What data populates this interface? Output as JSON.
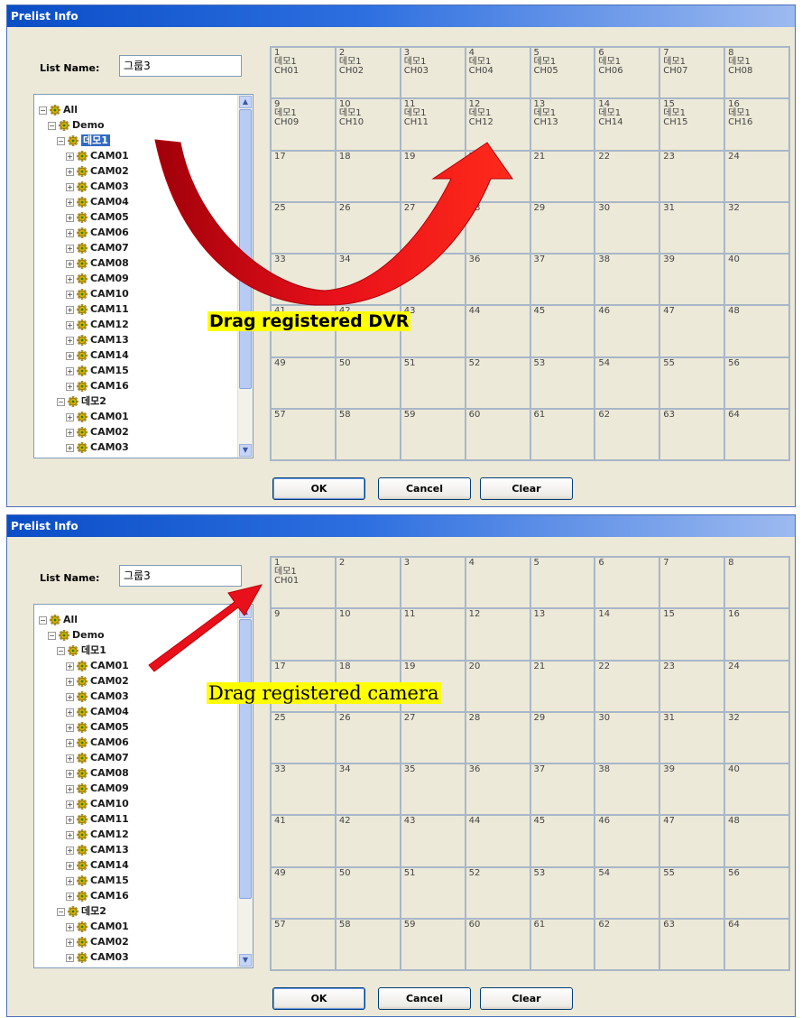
{
  "windows": [
    {
      "title": "Prelist Info",
      "list_name_label": "List Name:",
      "list_name_value": "그룹3",
      "tree": [
        {
          "label": "All",
          "level": 0,
          "expander": "−"
        },
        {
          "label": "Demo",
          "level": 1,
          "expander": "−"
        },
        {
          "label": "데모1",
          "level": 2,
          "expander": "−",
          "selected": true
        },
        {
          "label": "CAM01",
          "level": 3,
          "expander": "+"
        },
        {
          "label": "CAM02",
          "level": 3,
          "expander": "+"
        },
        {
          "label": "CAM03",
          "level": 3,
          "expander": "+"
        },
        {
          "label": "CAM04",
          "level": 3,
          "expander": "+"
        },
        {
          "label": "CAM05",
          "level": 3,
          "expander": "+"
        },
        {
          "label": "CAM06",
          "level": 3,
          "expander": "+"
        },
        {
          "label": "CAM07",
          "level": 3,
          "expander": "+"
        },
        {
          "label": "CAM08",
          "level": 3,
          "expander": "+"
        },
        {
          "label": "CAM09",
          "level": 3,
          "expander": "+"
        },
        {
          "label": "CAM10",
          "level": 3,
          "expander": "+"
        },
        {
          "label": "CAM11",
          "level": 3,
          "expander": "+"
        },
        {
          "label": "CAM12",
          "level": 3,
          "expander": "+"
        },
        {
          "label": "CAM13",
          "level": 3,
          "expander": "+"
        },
        {
          "label": "CAM14",
          "level": 3,
          "expander": "+"
        },
        {
          "label": "CAM15",
          "level": 3,
          "expander": "+"
        },
        {
          "label": "CAM16",
          "level": 3,
          "expander": "+"
        },
        {
          "label": "데모2",
          "level": 2,
          "expander": "−"
        },
        {
          "label": "CAM01",
          "level": 3,
          "expander": "+"
        },
        {
          "label": "CAM02",
          "level": 3,
          "expander": "+"
        },
        {
          "label": "CAM03",
          "level": 3,
          "expander": "+"
        }
      ],
      "channel_assignments": [
        {
          "slot": 1,
          "dvr": "데모1",
          "channel": "CH01"
        },
        {
          "slot": 2,
          "dvr": "데모1",
          "channel": "CH02"
        },
        {
          "slot": 3,
          "dvr": "데모1",
          "channel": "CH03"
        },
        {
          "slot": 4,
          "dvr": "데모1",
          "channel": "CH04"
        },
        {
          "slot": 5,
          "dvr": "데모1",
          "channel": "CH05"
        },
        {
          "slot": 6,
          "dvr": "데모1",
          "channel": "CH06"
        },
        {
          "slot": 7,
          "dvr": "데모1",
          "channel": "CH07"
        },
        {
          "slot": 8,
          "dvr": "데모1",
          "channel": "CH08"
        },
        {
          "slot": 9,
          "dvr": "데모1",
          "channel": "CH09"
        },
        {
          "slot": 10,
          "dvr": "데모1",
          "channel": "CH10"
        },
        {
          "slot": 11,
          "dvr": "데모1",
          "channel": "CH11"
        },
        {
          "slot": 12,
          "dvr": "데모1",
          "channel": "CH12"
        },
        {
          "slot": 13,
          "dvr": "데모1",
          "channel": "CH13"
        },
        {
          "slot": 14,
          "dvr": "데모1",
          "channel": "CH14"
        },
        {
          "slot": 15,
          "dvr": "데모1",
          "channel": "CH15"
        },
        {
          "slot": 16,
          "dvr": "데모1",
          "channel": "CH16"
        }
      ],
      "buttons": {
        "ok": "OK",
        "cancel": "Cancel",
        "clear": "Clear"
      },
      "annotation": "Drag registered DVR"
    },
    {
      "title": "Prelist Info",
      "list_name_label": "List Name:",
      "list_name_value": "그룹3",
      "tree": [
        {
          "label": "All",
          "level": 0,
          "expander": "−"
        },
        {
          "label": "Demo",
          "level": 1,
          "expander": "−"
        },
        {
          "label": "데모1",
          "level": 2,
          "expander": "−"
        },
        {
          "label": "CAM01",
          "level": 3,
          "expander": "+"
        },
        {
          "label": "CAM02",
          "level": 3,
          "expander": "+"
        },
        {
          "label": "CAM03",
          "level": 3,
          "expander": "+"
        },
        {
          "label": "CAM04",
          "level": 3,
          "expander": "+"
        },
        {
          "label": "CAM05",
          "level": 3,
          "expander": "+"
        },
        {
          "label": "CAM06",
          "level": 3,
          "expander": "+"
        },
        {
          "label": "CAM07",
          "level": 3,
          "expander": "+"
        },
        {
          "label": "CAM08",
          "level": 3,
          "expander": "+"
        },
        {
          "label": "CAM09",
          "level": 3,
          "expander": "+"
        },
        {
          "label": "CAM10",
          "level": 3,
          "expander": "+"
        },
        {
          "label": "CAM11",
          "level": 3,
          "expander": "+"
        },
        {
          "label": "CAM12",
          "level": 3,
          "expander": "+"
        },
        {
          "label": "CAM13",
          "level": 3,
          "expander": "+"
        },
        {
          "label": "CAM14",
          "level": 3,
          "expander": "+"
        },
        {
          "label": "CAM15",
          "level": 3,
          "expander": "+"
        },
        {
          "label": "CAM16",
          "level": 3,
          "expander": "+"
        },
        {
          "label": "데모2",
          "level": 2,
          "expander": "−"
        },
        {
          "label": "CAM01",
          "level": 3,
          "expander": "+"
        },
        {
          "label": "CAM02",
          "level": 3,
          "expander": "+"
        },
        {
          "label": "CAM03",
          "level": 3,
          "expander": "+"
        }
      ],
      "channel_assignments": [
        {
          "slot": 1,
          "dvr": "데모1",
          "channel": "CH01"
        }
      ],
      "buttons": {
        "ok": "OK",
        "cancel": "Cancel",
        "clear": "Clear"
      },
      "annotation": "Drag registered camera"
    }
  ],
  "colors": {
    "arrow_red": "#e8101a",
    "highlight": "#ffff00",
    "selection": "#316ac5"
  },
  "icons": {
    "tree_node": "gear-icon",
    "expand": "expander-icon"
  }
}
